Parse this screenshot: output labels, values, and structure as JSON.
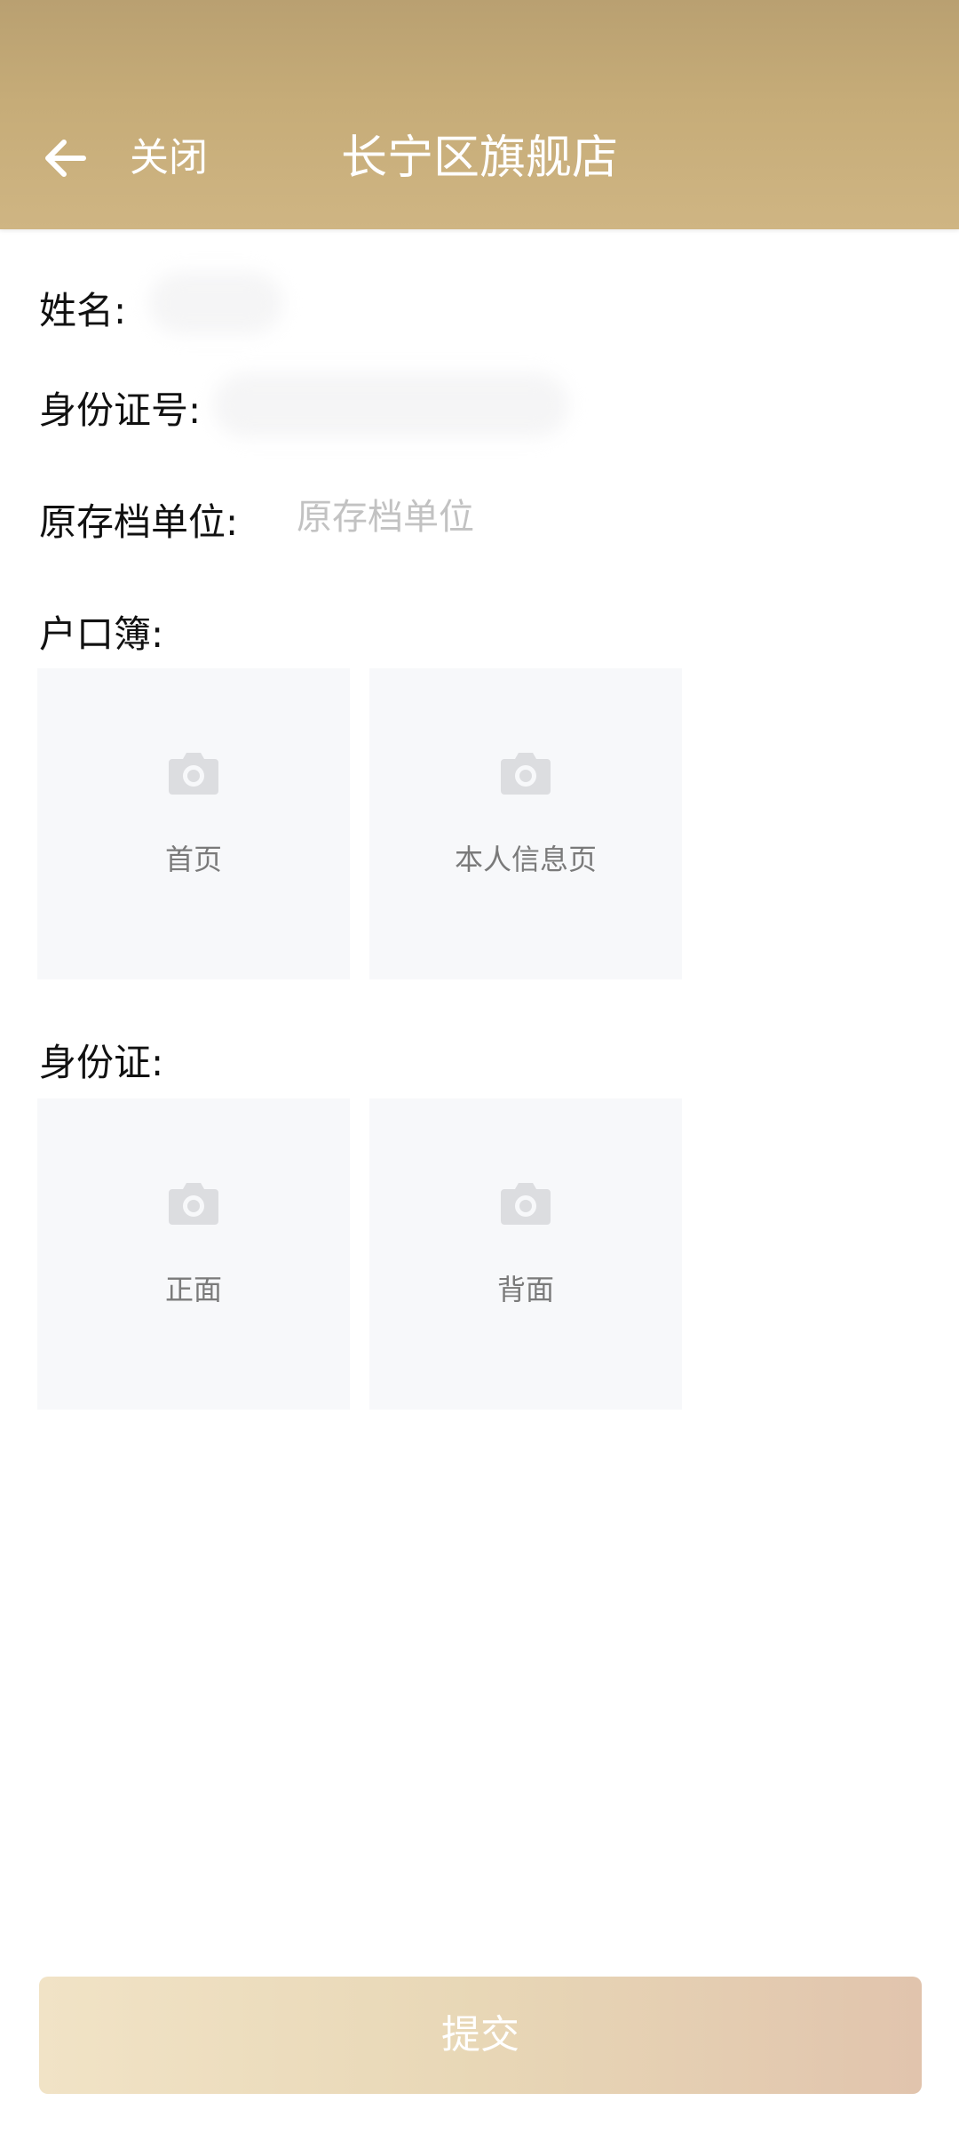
{
  "header": {
    "close_label": "关闭",
    "title": "长宁区旗舰店",
    "back_icon": "arrow-left-icon"
  },
  "form": {
    "name_label": "姓名:",
    "name_value": "",
    "id_number_label": "身份证号:",
    "id_number_value": "",
    "archive_unit_label": "原存档单位:",
    "archive_unit_placeholder": "原存档单位",
    "archive_unit_value": "",
    "household_register_label": "户口簿:",
    "household_register_tiles": [
      {
        "label": "首页",
        "icon": "camera-icon"
      },
      {
        "label": "本人信息页",
        "icon": "camera-icon"
      }
    ],
    "id_card_label": "身份证:",
    "id_card_tiles": [
      {
        "label": "正面",
        "icon": "camera-icon"
      },
      {
        "label": "背面",
        "icon": "camera-icon"
      }
    ]
  },
  "footer": {
    "submit_label": "提交"
  },
  "colors": {
    "header_bg": "#c6ac78",
    "tile_bg": "#f7f8fa",
    "placeholder": "#c2c2c2",
    "submit_bg_start": "#f1e3c6",
    "submit_bg_end": "#e1c4ad"
  }
}
